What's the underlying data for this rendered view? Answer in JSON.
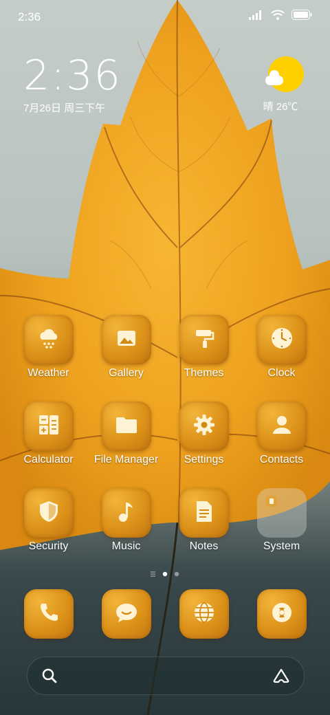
{
  "status_bar": {
    "time": "2:36"
  },
  "clock_widget": {
    "time": "2:36",
    "date": "7月26日 周三下午"
  },
  "weather_widget": {
    "text": "晴 26℃"
  },
  "apps": [
    {
      "label": "Weather",
      "icon": "cloud-snow-icon"
    },
    {
      "label": "Gallery",
      "icon": "image-icon"
    },
    {
      "label": "Themes",
      "icon": "paint-roller-icon"
    },
    {
      "label": "Clock",
      "icon": "clock-icon"
    },
    {
      "label": "Calculator",
      "icon": "calculator-icon"
    },
    {
      "label": "File Manager",
      "icon": "folder-icon"
    },
    {
      "label": "Settings",
      "icon": "gear-icon"
    },
    {
      "label": "Contacts",
      "icon": "person-icon"
    },
    {
      "label": "Security",
      "icon": "shield-icon"
    },
    {
      "label": "Music",
      "icon": "music-note-icon"
    },
    {
      "label": "Notes",
      "icon": "note-icon"
    },
    {
      "label": "System",
      "icon": "folder-group-icon"
    }
  ],
  "dock": [
    {
      "icon": "phone-icon"
    },
    {
      "icon": "message-icon"
    },
    {
      "icon": "browser-icon"
    },
    {
      "icon": "camera-icon"
    }
  ],
  "page_indicator": {
    "pages": 2,
    "active": 1
  },
  "colors": {
    "tile": "#dc9219",
    "sun": "#ffcf00",
    "leaf": "#f0a526"
  }
}
